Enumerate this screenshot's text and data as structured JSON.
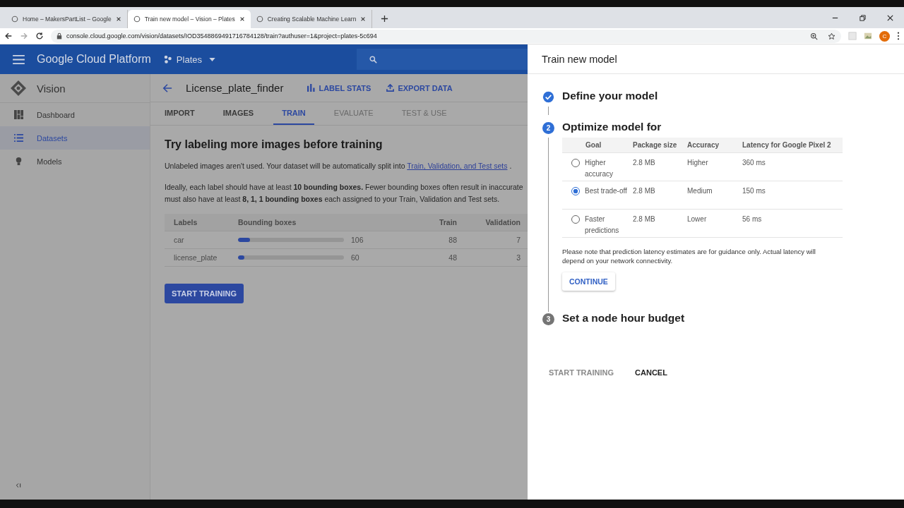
{
  "browser": {
    "tabs": [
      {
        "title": "Home – MakersPartList – Google",
        "selected": false
      },
      {
        "title": "Train new model – Vision – Plates",
        "selected": true
      },
      {
        "title": "Creating Scalable Machine Learn",
        "selected": false
      }
    ],
    "url": "console.cloud.google.com/vision/datasets/IOD3548869491716784128/train?authuser=1&project=plates-5c694",
    "profile_initial": "C"
  },
  "header": {
    "product": "Google Cloud Platform",
    "project": "Plates"
  },
  "sidebar": {
    "title": "Vision",
    "items": [
      {
        "label": "Dashboard",
        "selected": false
      },
      {
        "label": "Datasets",
        "selected": true
      },
      {
        "label": "Models",
        "selected": false
      }
    ]
  },
  "dataset": {
    "name": "License_plate_finder",
    "actions": [
      "LABEL STATS",
      "EXPORT DATA"
    ],
    "tabs": [
      {
        "label": "IMPORT",
        "selected": false,
        "disabled": false
      },
      {
        "label": "IMAGES",
        "selected": false,
        "disabled": false
      },
      {
        "label": "TRAIN",
        "selected": true,
        "disabled": false
      },
      {
        "label": "EVALUATE",
        "selected": false,
        "disabled": true
      },
      {
        "label": "TEST & USE",
        "selected": false,
        "disabled": true
      }
    ]
  },
  "train": {
    "heading": "Try labeling more images before training",
    "intro": "Unlabeled images aren't used. Your dataset will be automatically split into",
    "intro_link": "Train, Validation, and Test sets",
    "intro_end": ".",
    "advice_lines": [
      "Ideally, each label should have at least **10 bounding boxes.** Fewer bounding boxes often result in inaccurate",
      "must also have at least **8, 1, 1 bounding boxes** each assigned to your Train, Validation and Test sets."
    ],
    "table": {
      "columns": [
        "Labels",
        "Bounding boxes",
        "Train",
        "Validation"
      ],
      "rows": [
        {
          "label": "car",
          "level": 0.11,
          "boxes": "106",
          "train": "88",
          "validation": "7"
        },
        {
          "label": "license_plate",
          "level": 0.06,
          "boxes": "60",
          "train": "48",
          "validation": "3"
        }
      ]
    },
    "button": "START TRAINING"
  },
  "panel": {
    "title": "Train new model",
    "steps": [
      {
        "title": "Define your model",
        "done": true,
        "active": false
      },
      {
        "number": "2",
        "title": "Optimize model for",
        "done": false,
        "active": true
      },
      {
        "number": "3",
        "title": "Set a node hour budget",
        "done": false,
        "active": false
      }
    ],
    "columns": [
      "Goal",
      "Package size",
      "Accuracy",
      "Latency for Google Pixel 2"
    ],
    "options": [
      {
        "goal": "Higher accuracy",
        "size": "2.8 MB",
        "accuracy": "Higher",
        "latency": "360 ms",
        "selected": false
      },
      {
        "goal": "Best trade-off",
        "size": "2.8 MB",
        "accuracy": "Medium",
        "latency": "150 ms",
        "selected": true
      },
      {
        "goal": "Faster predictions",
        "size": "2.8 MB",
        "accuracy": "Lower",
        "latency": "56 ms",
        "selected": false
      }
    ],
    "note": "Please note that prediction latency estimates are for guidance only. Actual latency will depend on your network connectivity.",
    "continue": "CONTINUE",
    "buttons": [
      {
        "label": "START TRAINING",
        "disabled": true
      },
      {
        "label": "CANCEL",
        "disabled": false
      }
    ]
  }
}
